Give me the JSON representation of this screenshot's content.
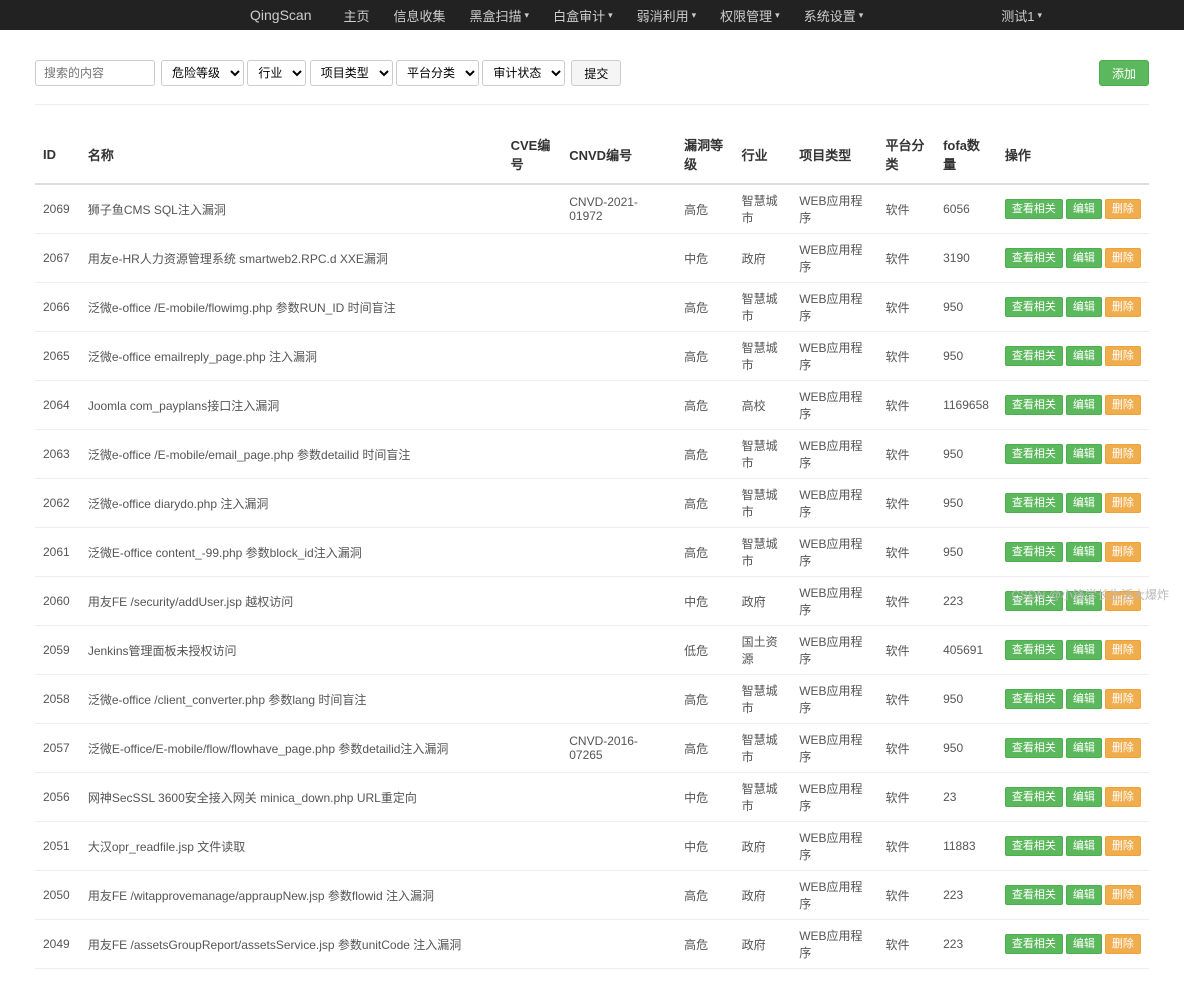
{
  "brand": "QingScan",
  "nav": {
    "items": [
      "主页",
      "信息收集",
      "黑盒扫描",
      "白盒审计",
      "弱消利用",
      "权限管理",
      "系统设置"
    ],
    "dropdown_flags": [
      false,
      false,
      true,
      true,
      true,
      true,
      true
    ],
    "right": "测试1"
  },
  "filters": {
    "search_placeholder": "搜索的内容",
    "selects": [
      "危险等级",
      "行业",
      "项目类型",
      "平台分类",
      "审计状态"
    ],
    "submit": "提交",
    "add": "添加"
  },
  "table": {
    "headers": [
      "ID",
      "名称",
      "CVE编号",
      "CNVD编号",
      "漏洞等级",
      "行业",
      "项目类型",
      "平台分类",
      "fofa数量",
      "操作"
    ],
    "actions": [
      "查看相关",
      "编辑",
      "删除"
    ],
    "rows": [
      {
        "id": "2069",
        "name": "狮子鱼CMS SQL注入漏洞",
        "cve": "",
        "cnvd": "CNVD-2021-01972",
        "level": "高危",
        "industry": "智慧城市",
        "type": "WEB应用程序",
        "platform": "软件",
        "fofa": "6056"
      },
      {
        "id": "2067",
        "name": "用友e-HR人力资源管理系统 smartweb2.RPC.d XXE漏洞",
        "cve": "",
        "cnvd": "",
        "level": "中危",
        "industry": "政府",
        "type": "WEB应用程序",
        "platform": "软件",
        "fofa": "3190"
      },
      {
        "id": "2066",
        "name": "泛微e-office /E-mobile/flowimg.php 参数RUN_ID 时间盲注",
        "cve": "",
        "cnvd": "",
        "level": "高危",
        "industry": "智慧城市",
        "type": "WEB应用程序",
        "platform": "软件",
        "fofa": "950"
      },
      {
        "id": "2065",
        "name": "泛微e-office emailreply_page.php 注入漏洞",
        "cve": "",
        "cnvd": "",
        "level": "高危",
        "industry": "智慧城市",
        "type": "WEB应用程序",
        "platform": "软件",
        "fofa": "950"
      },
      {
        "id": "2064",
        "name": "Joomla com_payplans接口注入漏洞",
        "cve": "",
        "cnvd": "",
        "level": "高危",
        "industry": "高校",
        "type": "WEB应用程序",
        "platform": "软件",
        "fofa": "1169658"
      },
      {
        "id": "2063",
        "name": "泛微e-office /E-mobile/email_page.php 参数detailid 时间盲注",
        "cve": "",
        "cnvd": "",
        "level": "高危",
        "industry": "智慧城市",
        "type": "WEB应用程序",
        "platform": "软件",
        "fofa": "950"
      },
      {
        "id": "2062",
        "name": "泛微e-office diarydo.php 注入漏洞",
        "cve": "",
        "cnvd": "",
        "level": "高危",
        "industry": "智慧城市",
        "type": "WEB应用程序",
        "platform": "软件",
        "fofa": "950"
      },
      {
        "id": "2061",
        "name": "泛微E-office content_-99.php 参数block_id注入漏洞",
        "cve": "",
        "cnvd": "",
        "level": "高危",
        "industry": "智慧城市",
        "type": "WEB应用程序",
        "platform": "软件",
        "fofa": "950"
      },
      {
        "id": "2060",
        "name": "用友FE /security/addUser.jsp 越权访问",
        "cve": "",
        "cnvd": "",
        "level": "中危",
        "industry": "政府",
        "type": "WEB应用程序",
        "platform": "软件",
        "fofa": "223"
      },
      {
        "id": "2059",
        "name": "Jenkins管理面板未授权访问",
        "cve": "",
        "cnvd": "",
        "level": "低危",
        "industry": "国土资源",
        "type": "WEB应用程序",
        "platform": "软件",
        "fofa": "405691"
      },
      {
        "id": "2058",
        "name": "泛微e-office /client_converter.php 参数lang 时间盲注",
        "cve": "",
        "cnvd": "",
        "level": "高危",
        "industry": "智慧城市",
        "type": "WEB应用程序",
        "platform": "软件",
        "fofa": "950"
      },
      {
        "id": "2057",
        "name": "泛微E-office/E-mobile/flow/flowhave_page.php 参数detailid注入漏洞",
        "cve": "",
        "cnvd": "CNVD-2016-07265",
        "level": "高危",
        "industry": "智慧城市",
        "type": "WEB应用程序",
        "platform": "软件",
        "fofa": "950"
      },
      {
        "id": "2056",
        "name": "网神SecSSL 3600安全接入网关 minica_down.php URL重定向",
        "cve": "",
        "cnvd": "",
        "level": "中危",
        "industry": "智慧城市",
        "type": "WEB应用程序",
        "platform": "软件",
        "fofa": "23"
      },
      {
        "id": "2051",
        "name": "大汉opr_readfile.jsp 文件读取",
        "cve": "",
        "cnvd": "",
        "level": "中危",
        "industry": "政府",
        "type": "WEB应用程序",
        "platform": "软件",
        "fofa": "11883"
      },
      {
        "id": "2050",
        "name": "用友FE /witapprovemanage/appraupNew.jsp 参数flowid 注入漏洞",
        "cve": "",
        "cnvd": "",
        "level": "高危",
        "industry": "政府",
        "type": "WEB应用程序",
        "platform": "软件",
        "fofa": "223"
      },
      {
        "id": "2049",
        "name": "用友FE /assetsGroupReport/assetsService.jsp 参数unitCode 注入漏洞",
        "cve": "",
        "cnvd": "",
        "level": "高危",
        "industry": "政府",
        "type": "WEB应用程序",
        "platform": "软件",
        "fofa": "223"
      }
    ]
  },
  "watermark": "CSDN @小锋学长生活大爆炸"
}
